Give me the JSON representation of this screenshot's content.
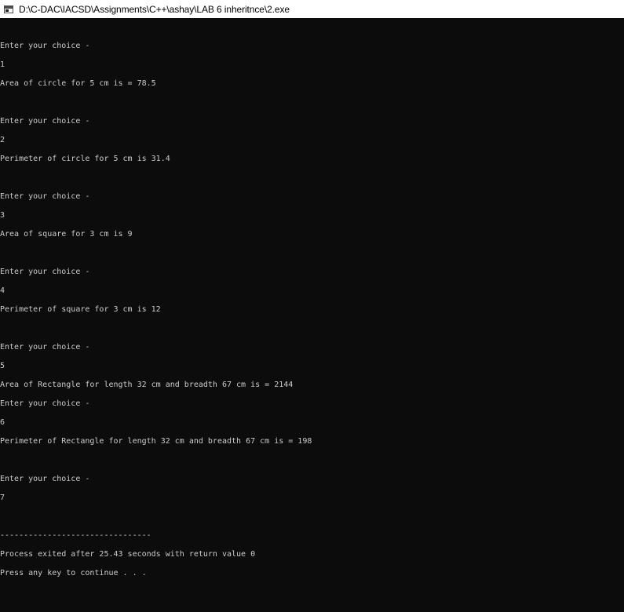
{
  "window": {
    "title": "D:\\C-DAC\\IACSD\\Assignments\\C++\\ashay\\LAB 6 inheritnce\\2.exe",
    "icon": "console-app-icon"
  },
  "colors": {
    "background": "#0c0c0c",
    "text": "#cccccc",
    "titlebar": "#ffffff"
  },
  "console": {
    "lines": [
      "Enter your choice -",
      "1",
      "Area of circle for 5 cm is = 78.5",
      "",
      "Enter your choice -",
      "2",
      "Perimeter of circle for 5 cm is 31.4",
      "",
      "Enter your choice -",
      "3",
      "Area of square for 3 cm is 9",
      "",
      "Enter your choice -",
      "4",
      "Perimeter of square for 3 cm is 12",
      "",
      "Enter your choice -",
      "5",
      "Area of Rectangle for length 32 cm and breadth 67 cm is = 2144",
      "Enter your choice -",
      "6",
      "Perimeter of Rectangle for length 32 cm and breadth 67 cm is = 198",
      "",
      "Enter your choice -",
      "7",
      "",
      "--------------------------------",
      "Process exited after 25.43 seconds with return value 0",
      "Press any key to continue . . ."
    ]
  }
}
